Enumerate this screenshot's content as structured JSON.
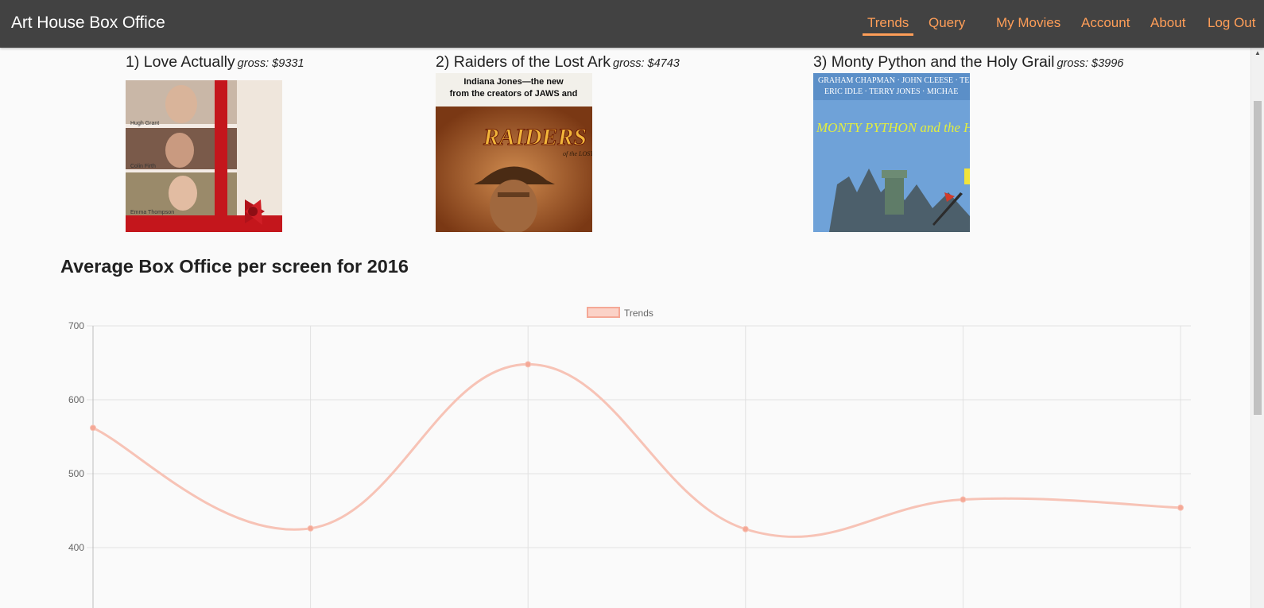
{
  "nav": {
    "brand": "Art House Box Office",
    "items": [
      {
        "label": "Trends",
        "active": true
      },
      {
        "label": "Query",
        "active": false
      },
      {
        "label": "My Movies",
        "active": false
      },
      {
        "label": "Account",
        "active": false
      },
      {
        "label": "About",
        "active": false
      },
      {
        "label": "Log Out",
        "active": false
      }
    ]
  },
  "top_movies": [
    {
      "title": "1) Love Actually",
      "gross": "gross: $9331",
      "poster_icon": "love-actually-poster",
      "poster_text": [
        "Hugh Grant",
        "Colin Firth",
        "Emma Thompson"
      ]
    },
    {
      "title": "2) Raiders of the Lost Ark",
      "gross": "gross: $4743",
      "poster_icon": "raiders-poster",
      "poster_text": [
        "Indiana Jones—the new",
        "from the creators of JAWS and",
        "RAIDERS",
        "of the LOST"
      ]
    },
    {
      "title": "3) Monty Python and the Holy Grail",
      "gross": "gross: $3996",
      "poster_icon": "monty-python-poster",
      "poster_text": [
        "GRAHAM CHAPMAN · JOHN CLEESE · TER",
        "ERIC IDLE · TERRY JONES · MICHAE",
        "MONTY PYTHON and the HOLY"
      ]
    }
  ],
  "section_title": "Average Box Office per screen for 2016",
  "chart_data": {
    "type": "line",
    "title": "",
    "xlabel": "",
    "ylabel": "",
    "series": [
      {
        "name": "Trends",
        "values": [
          562,
          426,
          648,
          425,
          465,
          454
        ]
      }
    ],
    "y_ticks": [
      700,
      600,
      500,
      400
    ],
    "y_visible_range": [
      317,
      700
    ],
    "grid": true,
    "legend": "top-center",
    "line_color": "#f7c3b6",
    "point_color": "#f5a896",
    "smooth": true
  },
  "colors": {
    "navbar_bg": "#424242",
    "accent": "#ff9e58",
    "page_bg": "#fafafa"
  }
}
